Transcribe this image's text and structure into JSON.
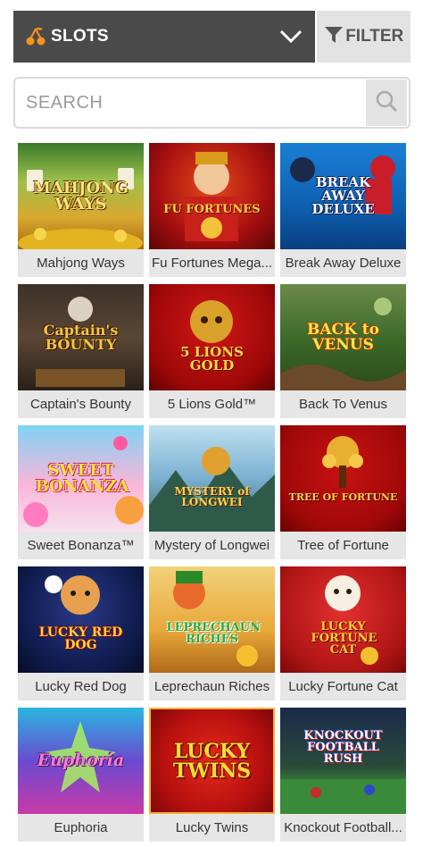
{
  "header": {
    "category_label": "SLOTS",
    "filter_label": "FILTER"
  },
  "search": {
    "placeholder": "SEARCH"
  },
  "games": [
    {
      "title": "Mahjong Ways",
      "logo": "MAHJONG WAYS"
    },
    {
      "title": "Fu Fortunes Mega...",
      "logo": "FU FORTUNES"
    },
    {
      "title": "Break Away Deluxe",
      "logo": "BREAK AWAY DELUXE"
    },
    {
      "title": "Captain's Bounty",
      "logo": "Captain's BOUNTY"
    },
    {
      "title": "5 Lions Gold™",
      "logo": "5 LIONS GOLD"
    },
    {
      "title": "Back To Venus",
      "logo": "BACK to VENUS"
    },
    {
      "title": "Sweet Bonanza™",
      "logo": "SWEET BONANZA"
    },
    {
      "title": "Mystery of Longwei",
      "logo": "MYSTERY of LONGWEI"
    },
    {
      "title": "Tree of Fortune",
      "logo": "TREE OF FORTUNE"
    },
    {
      "title": "Lucky Red Dog",
      "logo": "LUCKY RED DOG"
    },
    {
      "title": "Leprechaun Riches",
      "logo": "LEPRECHAUN RICHES"
    },
    {
      "title": "Lucky Fortune Cat",
      "logo": "LUCKY FORTUNE CAT"
    },
    {
      "title": "Euphoria",
      "logo": "Euphoria"
    },
    {
      "title": "Lucky Twins",
      "logo": "LUCKY TWINS"
    },
    {
      "title": "Knockout Football...",
      "logo": "KNOCKOUT FOOTBALL RUSH"
    }
  ],
  "colors": {
    "header_dark": "#4a4a4a",
    "accent_orange": "#f7931e",
    "card_bg": "#e6e6e6"
  }
}
